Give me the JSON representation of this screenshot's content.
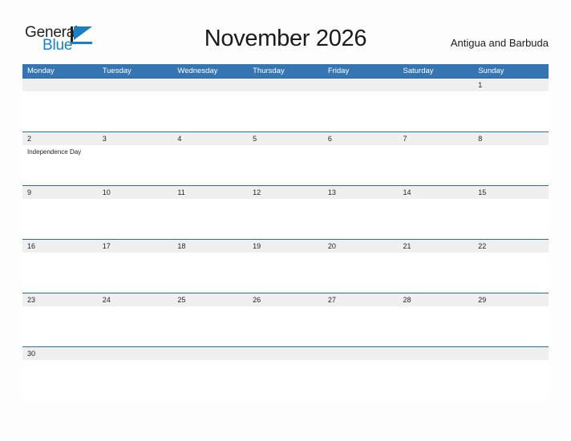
{
  "brand": {
    "word1": "General",
    "word2": "Blue",
    "logo_dark": "#231f20",
    "logo_blue": "#1b7fc4"
  },
  "header": {
    "title": "November 2026",
    "location": "Antigua and Barbuda"
  },
  "theme": {
    "header_blue": "#3575b4",
    "row_border_blue": "#2e6da4",
    "daynum_band_gray": "#efefef",
    "page_background": "#fdfdfd",
    "text_dark": "#231f20"
  },
  "calendar": {
    "weekdays": [
      "Monday",
      "Tuesday",
      "Wednesday",
      "Thursday",
      "Friday",
      "Saturday",
      "Sunday"
    ],
    "weeks": [
      {
        "days": [
          {
            "num": "",
            "event": ""
          },
          {
            "num": "",
            "event": ""
          },
          {
            "num": "",
            "event": ""
          },
          {
            "num": "",
            "event": ""
          },
          {
            "num": "",
            "event": ""
          },
          {
            "num": "",
            "event": ""
          },
          {
            "num": "1",
            "event": ""
          }
        ]
      },
      {
        "days": [
          {
            "num": "2",
            "event": "Independence Day"
          },
          {
            "num": "3",
            "event": ""
          },
          {
            "num": "4",
            "event": ""
          },
          {
            "num": "5",
            "event": ""
          },
          {
            "num": "6",
            "event": ""
          },
          {
            "num": "7",
            "event": ""
          },
          {
            "num": "8",
            "event": ""
          }
        ]
      },
      {
        "days": [
          {
            "num": "9",
            "event": ""
          },
          {
            "num": "10",
            "event": ""
          },
          {
            "num": "11",
            "event": ""
          },
          {
            "num": "12",
            "event": ""
          },
          {
            "num": "13",
            "event": ""
          },
          {
            "num": "14",
            "event": ""
          },
          {
            "num": "15",
            "event": ""
          }
        ]
      },
      {
        "days": [
          {
            "num": "16",
            "event": ""
          },
          {
            "num": "17",
            "event": ""
          },
          {
            "num": "18",
            "event": ""
          },
          {
            "num": "19",
            "event": ""
          },
          {
            "num": "20",
            "event": ""
          },
          {
            "num": "21",
            "event": ""
          },
          {
            "num": "22",
            "event": ""
          }
        ]
      },
      {
        "days": [
          {
            "num": "23",
            "event": ""
          },
          {
            "num": "24",
            "event": ""
          },
          {
            "num": "25",
            "event": ""
          },
          {
            "num": "26",
            "event": ""
          },
          {
            "num": "27",
            "event": ""
          },
          {
            "num": "28",
            "event": ""
          },
          {
            "num": "29",
            "event": ""
          }
        ]
      },
      {
        "days": [
          {
            "num": "30",
            "event": ""
          },
          {
            "num": "",
            "event": ""
          },
          {
            "num": "",
            "event": ""
          },
          {
            "num": "",
            "event": ""
          },
          {
            "num": "",
            "event": ""
          },
          {
            "num": "",
            "event": ""
          },
          {
            "num": "",
            "event": ""
          }
        ]
      }
    ]
  }
}
